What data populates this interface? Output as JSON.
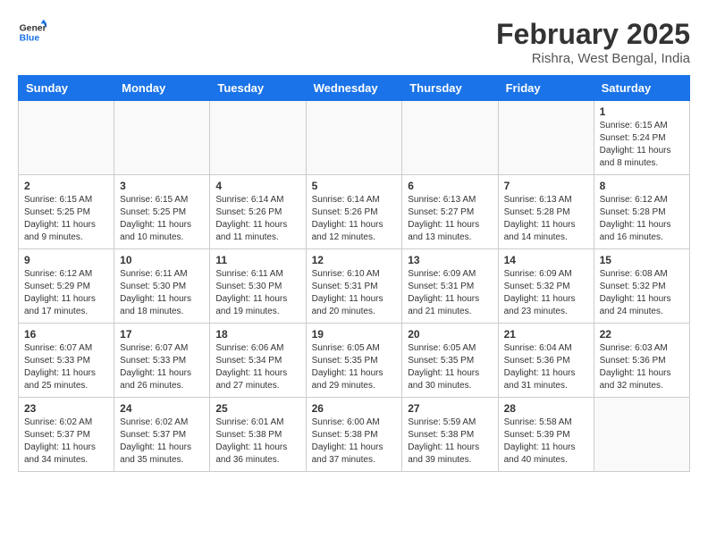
{
  "header": {
    "logo_line1": "General",
    "logo_line2": "Blue",
    "title": "February 2025",
    "subtitle": "Rishra, West Bengal, India"
  },
  "days_of_week": [
    "Sunday",
    "Monday",
    "Tuesday",
    "Wednesday",
    "Thursday",
    "Friday",
    "Saturday"
  ],
  "weeks": [
    [
      {
        "day": "",
        "info": ""
      },
      {
        "day": "",
        "info": ""
      },
      {
        "day": "",
        "info": ""
      },
      {
        "day": "",
        "info": ""
      },
      {
        "day": "",
        "info": ""
      },
      {
        "day": "",
        "info": ""
      },
      {
        "day": "1",
        "info": "Sunrise: 6:15 AM\nSunset: 5:24 PM\nDaylight: 11 hours and 8 minutes."
      }
    ],
    [
      {
        "day": "2",
        "info": "Sunrise: 6:15 AM\nSunset: 5:25 PM\nDaylight: 11 hours and 9 minutes."
      },
      {
        "day": "3",
        "info": "Sunrise: 6:15 AM\nSunset: 5:25 PM\nDaylight: 11 hours and 10 minutes."
      },
      {
        "day": "4",
        "info": "Sunrise: 6:14 AM\nSunset: 5:26 PM\nDaylight: 11 hours and 11 minutes."
      },
      {
        "day": "5",
        "info": "Sunrise: 6:14 AM\nSunset: 5:26 PM\nDaylight: 11 hours and 12 minutes."
      },
      {
        "day": "6",
        "info": "Sunrise: 6:13 AM\nSunset: 5:27 PM\nDaylight: 11 hours and 13 minutes."
      },
      {
        "day": "7",
        "info": "Sunrise: 6:13 AM\nSunset: 5:28 PM\nDaylight: 11 hours and 14 minutes."
      },
      {
        "day": "8",
        "info": "Sunrise: 6:12 AM\nSunset: 5:28 PM\nDaylight: 11 hours and 16 minutes."
      }
    ],
    [
      {
        "day": "9",
        "info": "Sunrise: 6:12 AM\nSunset: 5:29 PM\nDaylight: 11 hours and 17 minutes."
      },
      {
        "day": "10",
        "info": "Sunrise: 6:11 AM\nSunset: 5:30 PM\nDaylight: 11 hours and 18 minutes."
      },
      {
        "day": "11",
        "info": "Sunrise: 6:11 AM\nSunset: 5:30 PM\nDaylight: 11 hours and 19 minutes."
      },
      {
        "day": "12",
        "info": "Sunrise: 6:10 AM\nSunset: 5:31 PM\nDaylight: 11 hours and 20 minutes."
      },
      {
        "day": "13",
        "info": "Sunrise: 6:09 AM\nSunset: 5:31 PM\nDaylight: 11 hours and 21 minutes."
      },
      {
        "day": "14",
        "info": "Sunrise: 6:09 AM\nSunset: 5:32 PM\nDaylight: 11 hours and 23 minutes."
      },
      {
        "day": "15",
        "info": "Sunrise: 6:08 AM\nSunset: 5:32 PM\nDaylight: 11 hours and 24 minutes."
      }
    ],
    [
      {
        "day": "16",
        "info": "Sunrise: 6:07 AM\nSunset: 5:33 PM\nDaylight: 11 hours and 25 minutes."
      },
      {
        "day": "17",
        "info": "Sunrise: 6:07 AM\nSunset: 5:33 PM\nDaylight: 11 hours and 26 minutes."
      },
      {
        "day": "18",
        "info": "Sunrise: 6:06 AM\nSunset: 5:34 PM\nDaylight: 11 hours and 27 minutes."
      },
      {
        "day": "19",
        "info": "Sunrise: 6:05 AM\nSunset: 5:35 PM\nDaylight: 11 hours and 29 minutes."
      },
      {
        "day": "20",
        "info": "Sunrise: 6:05 AM\nSunset: 5:35 PM\nDaylight: 11 hours and 30 minutes."
      },
      {
        "day": "21",
        "info": "Sunrise: 6:04 AM\nSunset: 5:36 PM\nDaylight: 11 hours and 31 minutes."
      },
      {
        "day": "22",
        "info": "Sunrise: 6:03 AM\nSunset: 5:36 PM\nDaylight: 11 hours and 32 minutes."
      }
    ],
    [
      {
        "day": "23",
        "info": "Sunrise: 6:02 AM\nSunset: 5:37 PM\nDaylight: 11 hours and 34 minutes."
      },
      {
        "day": "24",
        "info": "Sunrise: 6:02 AM\nSunset: 5:37 PM\nDaylight: 11 hours and 35 minutes."
      },
      {
        "day": "25",
        "info": "Sunrise: 6:01 AM\nSunset: 5:38 PM\nDaylight: 11 hours and 36 minutes."
      },
      {
        "day": "26",
        "info": "Sunrise: 6:00 AM\nSunset: 5:38 PM\nDaylight: 11 hours and 37 minutes."
      },
      {
        "day": "27",
        "info": "Sunrise: 5:59 AM\nSunset: 5:38 PM\nDaylight: 11 hours and 39 minutes."
      },
      {
        "day": "28",
        "info": "Sunrise: 5:58 AM\nSunset: 5:39 PM\nDaylight: 11 hours and 40 minutes."
      },
      {
        "day": "",
        "info": ""
      }
    ]
  ]
}
